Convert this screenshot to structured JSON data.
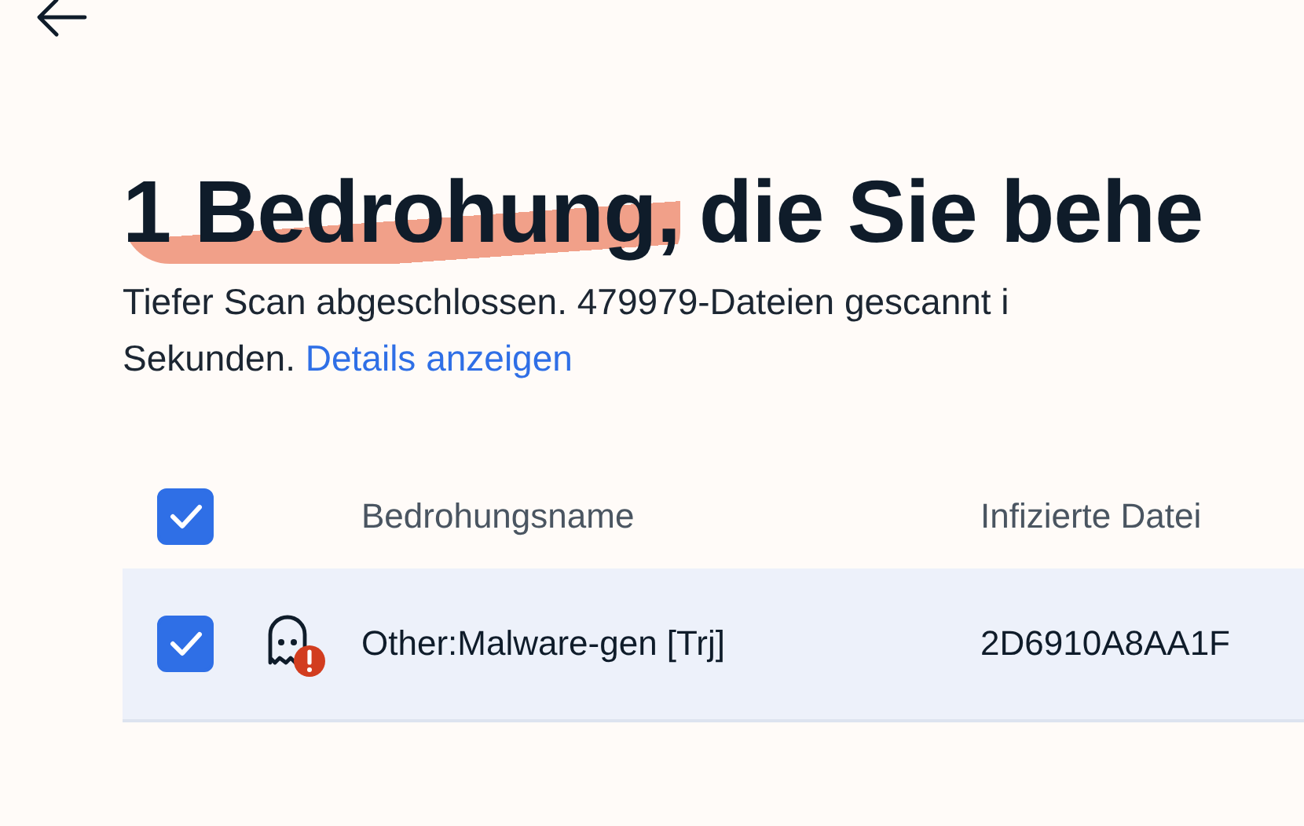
{
  "heading": {
    "highlighted": "1 Bedrohung,",
    "rest": "die Sie behe"
  },
  "description": {
    "lines": [
      "Tiefer Scan abgeschlossen. 479979-Dateien gescannt i",
      "Sekunden."
    ],
    "link": "Details anzeigen"
  },
  "table": {
    "select_all": {
      "checked": true
    },
    "columns": [
      "Bedrohungsname",
      "Infizierte Datei"
    ],
    "rows": [
      {
        "checked": true,
        "selected": true,
        "name": "Other:Malware-gen [Trj]",
        "file": "2D6910A8AA1F"
      }
    ]
  }
}
